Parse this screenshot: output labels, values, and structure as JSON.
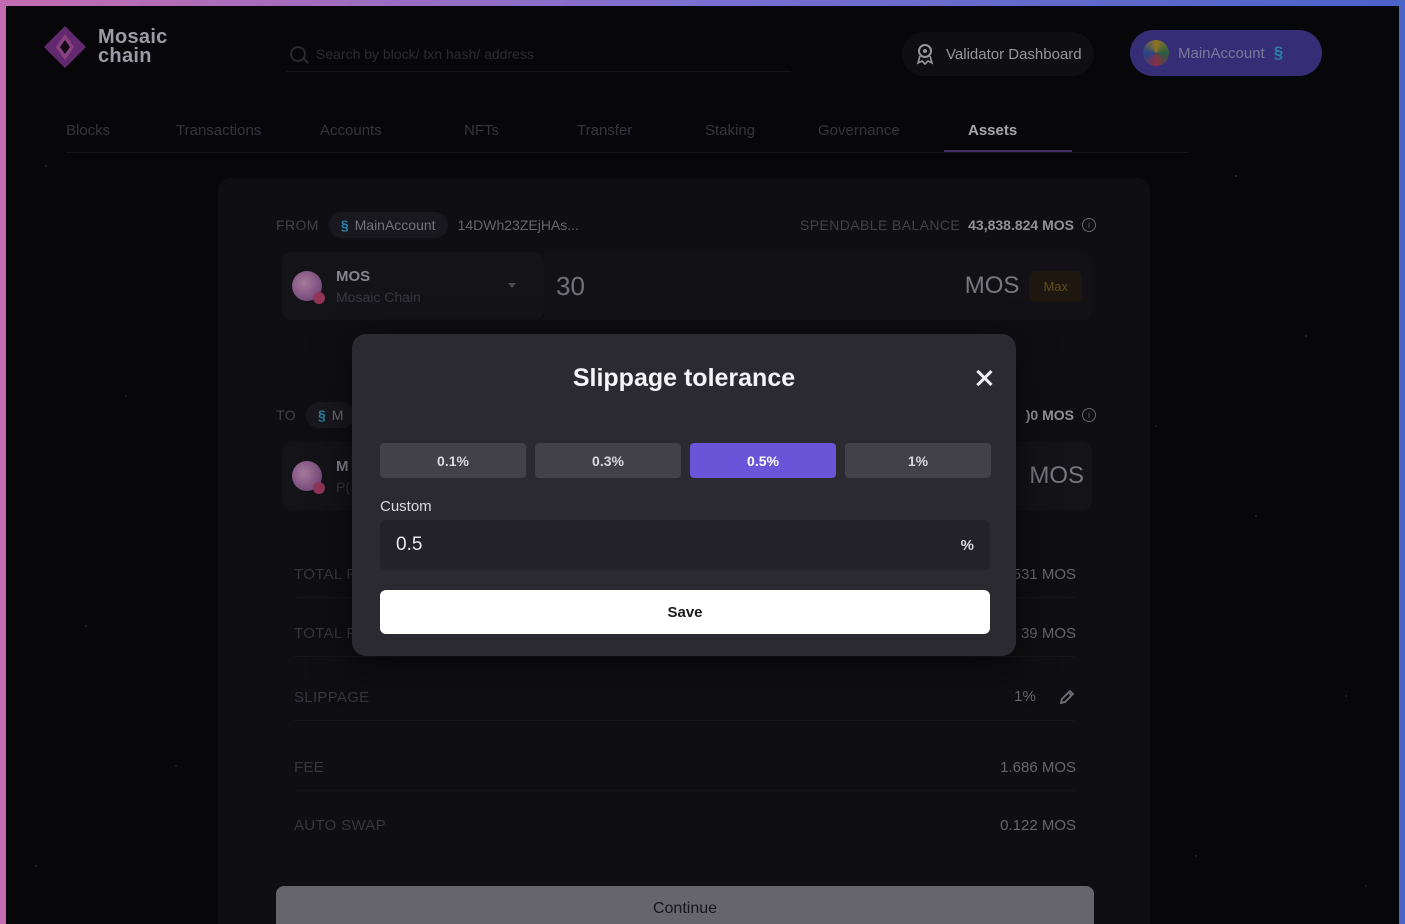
{
  "brand": {
    "name_line1": "Mosaic",
    "name_line2": "chain"
  },
  "search": {
    "placeholder": "Search by block/ txn hash/ address"
  },
  "header": {
    "validator_label": "Validator Dashboard",
    "account_label": "MainAccount"
  },
  "nav": {
    "items": [
      {
        "label": "Blocks"
      },
      {
        "label": "Transactions"
      },
      {
        "label": "Accounts"
      },
      {
        "label": "NFTs"
      },
      {
        "label": "Transfer"
      },
      {
        "label": "Staking"
      },
      {
        "label": "Governance"
      },
      {
        "label": "Assets",
        "active": true
      }
    ]
  },
  "swap": {
    "from_label": "FROM",
    "from_account": "MainAccount",
    "from_address": "14DWh23ZEjHAs...",
    "spendable_label": "SPENDABLE BALANCE",
    "spendable_value": "43,838.824 MOS",
    "token_symbol": "MOS",
    "token_name": "Mosaic Chain",
    "amount": "30",
    "amount_unit": "MOS",
    "max_label": "Max",
    "to_label": "TO",
    "to_account_partial": "M",
    "to_balance_partial": ")0 MOS",
    "to_token_partial": "M",
    "to_token_sub_partial": "P(",
    "to_unit": "MOS",
    "rows": [
      {
        "key": "TOTAL R",
        "value": "531 MOS"
      },
      {
        "key": "TOTAL P",
        "value": "39 MOS"
      },
      {
        "key": "SLIPPAGE",
        "value": "1%"
      },
      {
        "key": "FEE",
        "value": "1.686 MOS"
      },
      {
        "key": "AUTO SWAP",
        "value": "0.122 MOS"
      }
    ],
    "continue_label": "Continue"
  },
  "modal": {
    "title": "Slippage tolerance",
    "presets": [
      {
        "label": "0.1%"
      },
      {
        "label": "0.3%"
      },
      {
        "label": "0.5%",
        "active": true
      },
      {
        "label": "1%"
      }
    ],
    "custom_label": "Custom",
    "custom_value": "0.5",
    "custom_unit": "%",
    "save_label": "Save"
  },
  "colors": {
    "accent": "#6a55d8",
    "account_button": "#4b3fa6",
    "background": "#0b0a0f"
  }
}
